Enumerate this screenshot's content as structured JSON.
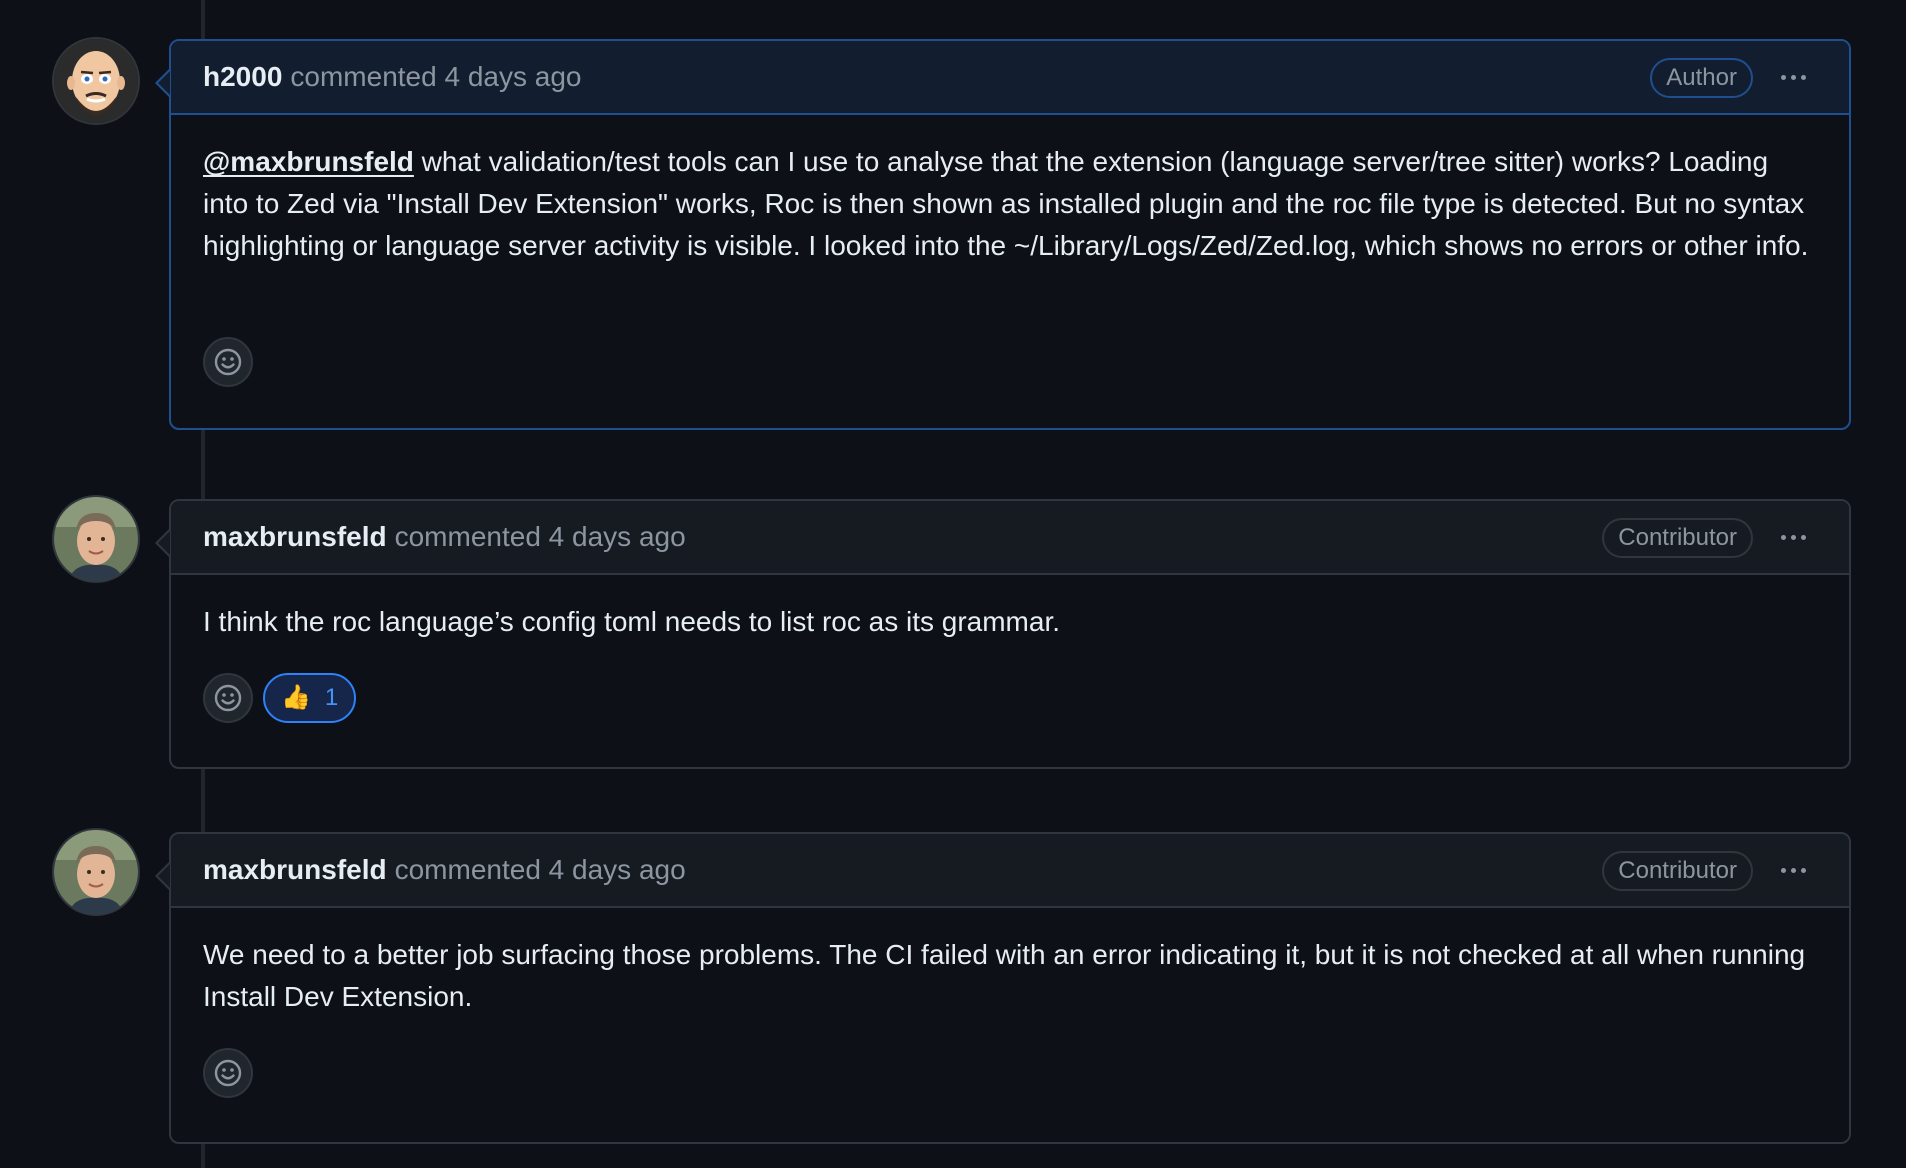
{
  "comments": [
    {
      "author": "h2000",
      "meta": "commented 4 days ago",
      "badge": "Author",
      "mention": "@maxbrunsfeld",
      "body_rest": " what validation/test tools can I use to analyse that the extension (language server/tree sitter) works? Loading into to Zed via \"Install Dev Extension\" works, Roc is then shown as installed plugin and the roc file type is detected. But no syntax highlighting or language server activity is visible. I looked into the ~/Library/Logs/Zed/Zed.log, which shows no errors or other info.",
      "avatar": "cartoon-avatar"
    },
    {
      "author": "maxbrunsfeld",
      "meta": "commented 4 days ago",
      "badge": "Contributor",
      "body": "I think the roc language’s config toml needs to list roc as its grammar.",
      "reaction": {
        "emoji": "👍",
        "count": "1"
      },
      "avatar": "photo-avatar"
    },
    {
      "author": "maxbrunsfeld",
      "meta": "commented 4 days ago",
      "badge": "Contributor",
      "body": "We need to a better job surfacing those problems. The CI failed with an error indicating it, but it is not checked at all when running Install Dev Extension.",
      "avatar": "photo-avatar"
    }
  ],
  "colors": {
    "background": "#0d1117",
    "author_border": "#1f4f8f",
    "reaction_accent": "#2f81f7"
  }
}
